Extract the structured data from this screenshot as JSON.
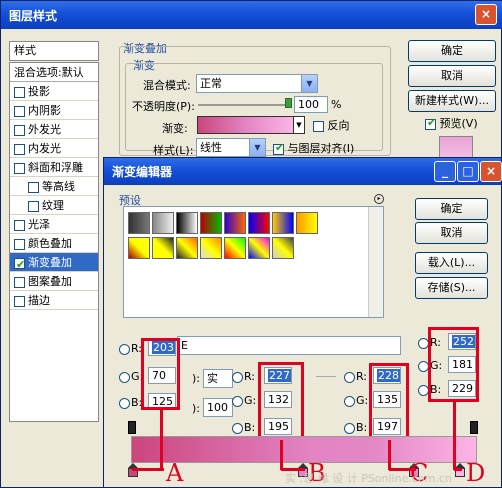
{
  "main": {
    "title": "图层样式",
    "close": "×"
  },
  "styles": {
    "header": "样式",
    "blend": "混合选项:默认",
    "items": [
      {
        "label": "投影",
        "checked": false,
        "indent": false
      },
      {
        "label": "内阴影",
        "checked": false,
        "indent": false
      },
      {
        "label": "外发光",
        "checked": false,
        "indent": false
      },
      {
        "label": "内发光",
        "checked": false,
        "indent": false
      },
      {
        "label": "斜面和浮雕",
        "checked": false,
        "indent": false
      },
      {
        "label": "等高线",
        "checked": false,
        "indent": true
      },
      {
        "label": "纹理",
        "checked": false,
        "indent": true
      },
      {
        "label": "光泽",
        "checked": false,
        "indent": false
      },
      {
        "label": "颜色叠加",
        "checked": false,
        "indent": false
      },
      {
        "label": "渐变叠加",
        "checked": true,
        "indent": false
      },
      {
        "label": "图案叠加",
        "checked": false,
        "indent": false
      },
      {
        "label": "描边",
        "checked": false,
        "indent": false
      }
    ]
  },
  "overlay": {
    "group": "渐变叠加",
    "sub": "渐变",
    "blend_label": "混合模式:",
    "blend_value": "正常",
    "opacity_label": "不透明度(P):",
    "opacity_value": "100",
    "pct": "%",
    "gradient_label": "渐变:",
    "reverse": "反向",
    "style_label": "样式(L):",
    "style_value": "线性",
    "align": "与图层对齐(I)"
  },
  "right": {
    "ok": "确定",
    "cancel": "取消",
    "newstyle": "新建样式(W)...",
    "preview": "预览(V)"
  },
  "editor": {
    "title": "渐变编辑器",
    "presets": "预设",
    "ok": "确定",
    "cancel": "取消",
    "load": "载入(L)...",
    "save": "存储(S)...",
    "name_partial": "E",
    "type_partial": "):",
    "type_val": "实",
    "smooth_partial": "):",
    "smooth_val": "100",
    "grad_colors": [
      "#cb467d",
      "#e384c3",
      "#e487c5",
      "#fcb5e5"
    ]
  },
  "rgb": [
    {
      "r": "203",
      "g": "70",
      "b": "125",
      "label": "A",
      "color": "#cb467d"
    },
    {
      "r": "227",
      "g": "132",
      "b": "195",
      "label": "B",
      "color": "#e384c3"
    },
    {
      "r": "228",
      "g": "135",
      "b": "197",
      "label": "C",
      "color": "#e487c5"
    },
    {
      "r": "252",
      "g": "181",
      "b": "229",
      "label": "D",
      "color": "#fcb5e5"
    }
  ],
  "letters": {
    "r": "R:",
    "g": "G:",
    "b": "B:"
  },
  "watermark": "实 :思 缘 设 计 PSonline.com.cn"
}
